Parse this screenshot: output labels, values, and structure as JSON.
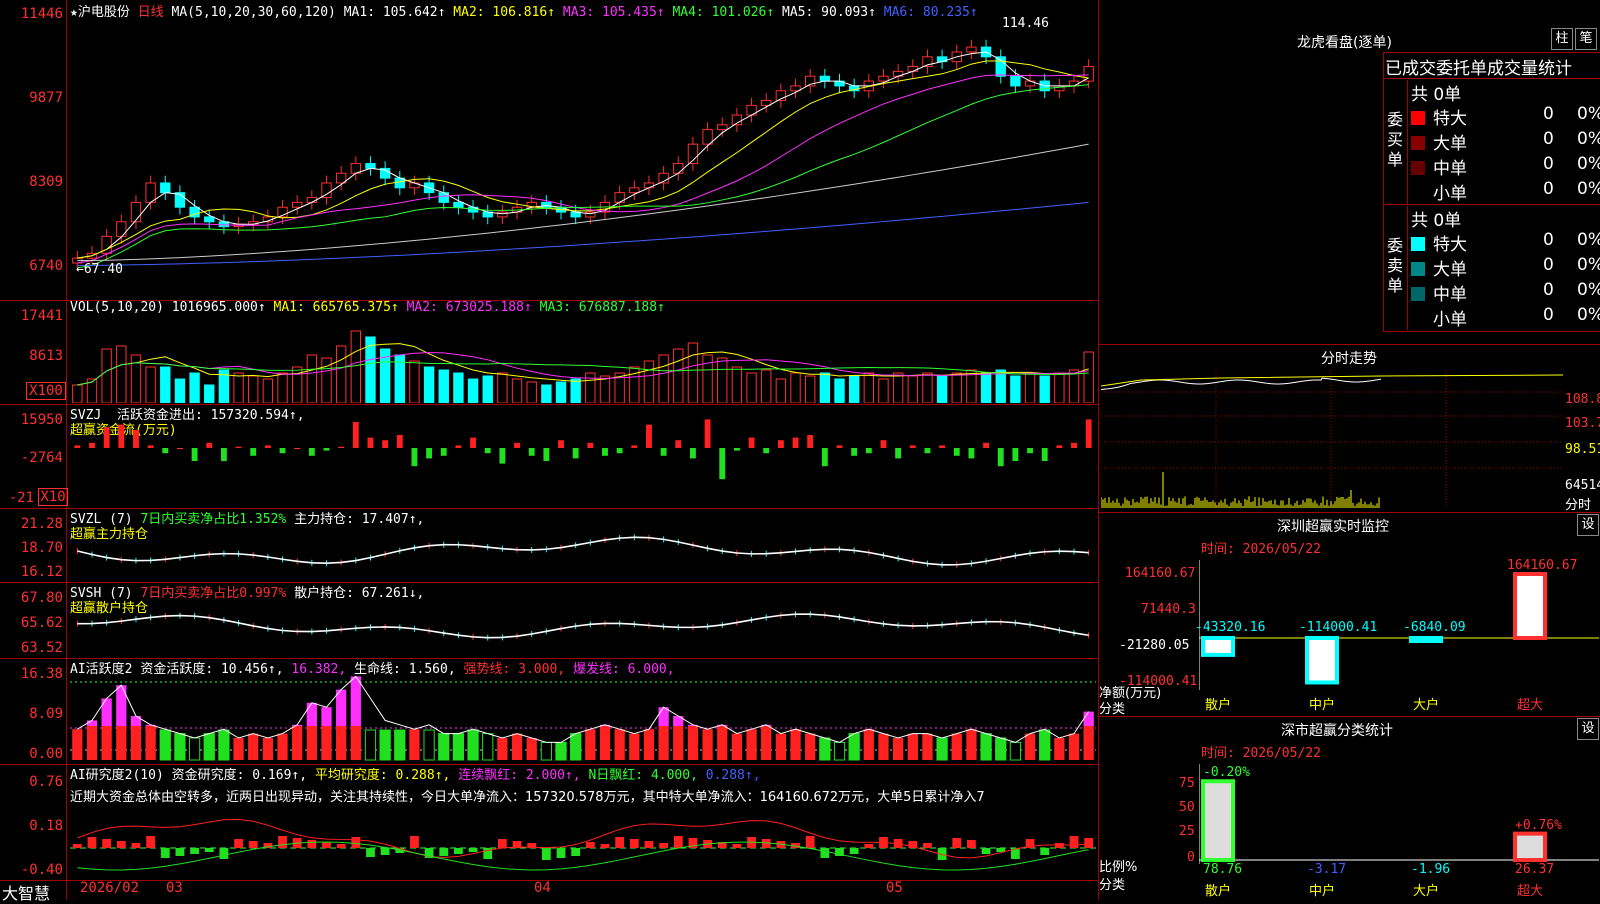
{
  "stock": {
    "star": "★",
    "name": "沪电股份",
    "period": "日线"
  },
  "kline": {
    "ma_header": "MA(5,10,20,30,60,120)",
    "ma_values": [
      {
        "label": "MA1: 105.642↑",
        "color": "#ffffff"
      },
      {
        "label": "MA2: 106.816↑",
        "color": "#ffff00"
      },
      {
        "label": "MA3: 105.435↑",
        "color": "#ff30ff"
      },
      {
        "label": "MA4: 101.026↑",
        "color": "#30ff30"
      },
      {
        "label": "MA5: 90.093↑",
        "color": "#ffffff"
      },
      {
        "label": "MA6: 80.235↑",
        "color": "#4060ff"
      }
    ],
    "yticks": [
      "11446",
      "9877",
      "8309",
      "6740"
    ],
    "high_label": "114.46",
    "low_label": "←67.40",
    "low_price": 67.4,
    "high_price": 114.46,
    "closes": [
      68.5,
      69.5,
      73,
      76,
      80,
      84,
      82,
      79,
      77,
      76,
      75,
      75.5,
      76,
      77,
      79,
      80,
      81,
      84,
      86,
      88,
      87,
      85,
      83,
      84,
      82,
      80,
      79,
      78,
      77,
      78,
      79,
      80,
      79,
      78,
      77,
      78,
      80,
      82,
      83,
      84,
      86,
      88,
      92,
      95,
      96,
      98,
      100,
      101,
      103,
      104,
      106,
      105,
      104,
      103,
      105,
      106,
      107,
      108,
      110,
      109,
      111,
      112,
      110,
      106,
      104,
      105,
      103,
      104,
      105,
      108
    ]
  },
  "volume": {
    "header": "VOL(5,10,20)",
    "vol": "1016965.000↑",
    "ma": [
      "MA1: 665765.375↑",
      "MA2: 673025.188↑",
      "MA3: 676887.188↑"
    ],
    "yticks": [
      "17441",
      "8613"
    ],
    "unit": "X100",
    "bars": [
      0.3,
      0.4,
      0.9,
      0.95,
      0.8,
      0.6,
      0.6,
      0.4,
      0.5,
      0.3,
      0.55,
      0.5,
      0.45,
      0.4,
      0.5,
      0.6,
      0.8,
      0.75,
      0.95,
      1.2,
      1.1,
      0.9,
      0.8,
      0.7,
      0.6,
      0.55,
      0.5,
      0.4,
      0.45,
      0.5,
      0.4,
      0.35,
      0.3,
      0.35,
      0.4,
      0.5,
      0.45,
      0.5,
      0.6,
      0.7,
      0.8,
      0.9,
      1.0,
      0.8,
      0.75,
      0.6,
      0.5,
      0.55,
      0.4,
      0.5,
      0.45,
      0.5,
      0.4,
      0.45,
      0.5,
      0.4,
      0.5,
      0.45,
      0.5,
      0.45,
      0.5,
      0.55,
      0.5,
      0.55,
      0.45,
      0.5,
      0.45,
      0.5,
      0.55,
      0.85
    ]
  },
  "svzj": {
    "header": "SVZJ",
    "label": "活跃资金进出: 157320.594↑,",
    "sub": "超赢资金流(万元)",
    "yticks": [
      "15950",
      "-2764",
      "-21"
    ],
    "unit": "X10",
    "vals": [
      0.1,
      0.2,
      0.8,
      0.9,
      0.7,
      0.1,
      -0.2,
      0,
      -0.5,
      0.2,
      -0.5,
      0.05,
      -0.3,
      0.1,
      -0.2,
      0,
      -0.3,
      -0.1,
      0.05,
      1.0,
      0.4,
      0.3,
      0.5,
      -0.7,
      -0.4,
      -0.3,
      0.1,
      0.4,
      -0.2,
      -0.6,
      0.2,
      -0.3,
      -0.5,
      0.3,
      -0.4,
      0.2,
      -0.3,
      -0.2,
      0.1,
      0.9,
      -0.3,
      0.3,
      -0.4,
      1.1,
      -1.2,
      -0.1,
      0.4,
      -0.2,
      0.3,
      0.4,
      0.5,
      -0.7,
      0.1,
      -0.3,
      -0.2,
      0.3,
      -0.4,
      0.1,
      -0.2,
      0.1,
      -0.3,
      -0.4,
      0.2,
      -0.7,
      -0.5,
      -0.2,
      -0.5,
      0.1,
      0.2,
      1.1
    ]
  },
  "svzl": {
    "header": "SVZL (7)",
    "label": "7日内买卖净占比1.352%",
    "pos": "主力持仓: 17.407↑,",
    "sub": "超赢主力持仓",
    "yticks": [
      "21.28",
      "18.70",
      "16.12"
    ]
  },
  "svsh": {
    "header": "SVSH (7)",
    "label": "7日内买卖净占比0.997%",
    "pos": "散户持仓: 67.261↓,",
    "sub": "超赢散户持仓",
    "yticks": [
      "67.80",
      "65.62",
      "63.52"
    ]
  },
  "ai_active": {
    "header": "AI活跃度2",
    "t1": "资金活跃度: 10.456↑,",
    "t2": "16.382,",
    "t3": "生命线: 1.560,",
    "t4": "强势线: 3.000,",
    "t5": "爆发线: 6.000,",
    "yticks": [
      "16.38",
      "8.09",
      "0.00"
    ],
    "bars": [
      0.35,
      0.45,
      0.7,
      0.85,
      0.5,
      0.4,
      0.35,
      0.3,
      0.25,
      0.3,
      0.35,
      0.25,
      0.3,
      0.25,
      0.3,
      0.4,
      0.65,
      0.6,
      0.8,
      0.95,
      0.7,
      0.45,
      0.4,
      0.35,
      0.4,
      0.3,
      0.3,
      0.35,
      0.3,
      0.25,
      0.3,
      0.25,
      0.2,
      0.2,
      0.3,
      0.35,
      0.4,
      0.35,
      0.3,
      0.35,
      0.6,
      0.5,
      0.4,
      0.35,
      0.4,
      0.3,
      0.35,
      0.4,
      0.3,
      0.35,
      0.3,
      0.25,
      0.2,
      0.3,
      0.35,
      0.3,
      0.25,
      0.3,
      0.3,
      0.25,
      0.3,
      0.35,
      0.3,
      0.25,
      0.2,
      0.3,
      0.35,
      0.25,
      0.3,
      0.55
    ]
  },
  "ai_research": {
    "header": "AI研究度2(10)",
    "t1": "资金研究度: 0.169↑,",
    "t2": "平均研究度: 0.288↑,",
    "t3": "连续飘红: 2.000↑,",
    "t4": "N日飘红: 4.000,",
    "t5": "0.288↑,",
    "comment": "近期大资金总体由空转多，近两日出现异动，关注其持续性，今日大单净流入：157320.578万元，其中特大单净流入：164160.672万元，大单5日累计净入7",
    "yticks": [
      "0.76",
      "0.18",
      "-0.40"
    ]
  },
  "xaxis": {
    "brand": "大智慧",
    "labels": [
      "2026/02",
      "03",
      "04",
      "05"
    ]
  },
  "right": {
    "lhb_title": "龙虎看盘(逐单)",
    "btn1": "柱",
    "btn2": "笔",
    "tabs": "已成交委托单成交量统计",
    "buy": {
      "side": "委买单",
      "total": "共 0单",
      "rows": [
        {
          "name": "特大",
          "v": "0",
          "p": "0%",
          "color": "#ff0000"
        },
        {
          "name": "大单",
          "v": "0",
          "p": "0%",
          "color": "#880000"
        },
        {
          "name": "中单",
          "v": "0",
          "p": "0%",
          "color": "#660000"
        },
        {
          "name": "小单",
          "v": "0",
          "p": "0%",
          "color": "#000000"
        }
      ]
    },
    "sell": {
      "side": "委卖单",
      "total": "共 0单",
      "rows": [
        {
          "name": "特大",
          "v": "0",
          "p": "0%",
          "color": "#00ffff"
        },
        {
          "name": "大单",
          "v": "0",
          "p": "0%",
          "color": "#008888"
        },
        {
          "name": "中单",
          "v": "0",
          "p": "0%",
          "color": "#006666"
        },
        {
          "name": "小单",
          "v": "0",
          "p": "0%",
          "color": "#000000"
        }
      ]
    },
    "fs_title": "分时走势",
    "fs_ticks": [
      "108.8",
      "103.7",
      "98.51",
      "64514"
    ],
    "fs_unit": "分时",
    "sz_title": "深圳超赢实时监控",
    "sz_btn": "设",
    "sz_time": "时间: 2026/05/22",
    "sz_yticks": [
      "164160.67",
      "71440.3",
      "-21280.05",
      "-114000.41"
    ],
    "sz_bars": [
      {
        "cat": "散户",
        "val": "-43320.16",
        "color": "#00ffff"
      },
      {
        "cat": "中户",
        "val": "-114000.41",
        "color": "#00ffff"
      },
      {
        "cat": "大户",
        "val": "-6840.09",
        "color": "#00ffff"
      },
      {
        "cat": "超大",
        "val": "164160.67",
        "color": "#ff3030"
      }
    ],
    "sz_ylabel": "净额(万元)",
    "sz_xlabel": "分类",
    "cls_title": "深市超赢分类统计",
    "cls_btn": "设",
    "cls_time": "时间: 2026/05/22",
    "cls_yticks": [
      "75",
      "50",
      "25",
      "0"
    ],
    "cls_bars": [
      {
        "cat": "散户",
        "top": "-0.20%",
        "bottom": "78.76"
      },
      {
        "cat": "中户",
        "top": "",
        "bottom": "-3.17"
      },
      {
        "cat": "大户",
        "top": "",
        "bottom": "-1.96"
      },
      {
        "cat": "超大",
        "top": "+0.76%",
        "bottom": "26.37"
      }
    ],
    "cls_ylabel": "比例%",
    "cls_xlabel": "分类"
  }
}
